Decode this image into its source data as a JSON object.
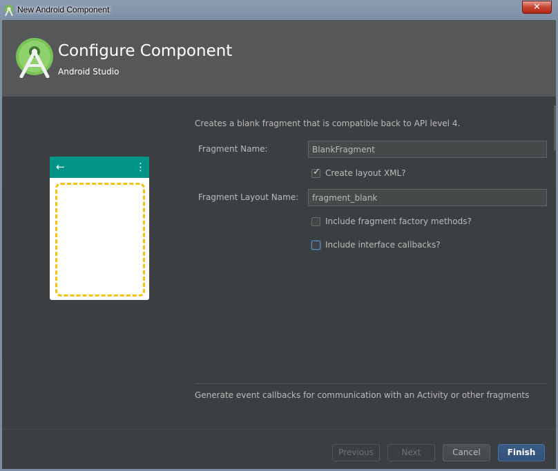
{
  "window": {
    "title": "New Android Component"
  },
  "header": {
    "title": "Configure Component",
    "subtitle": "Android Studio"
  },
  "form": {
    "description": "Creates a blank fragment that is compatible back to API level 4.",
    "fragment_name": {
      "label": "Fragment Name:",
      "value": "BlankFragment"
    },
    "create_layout_xml": {
      "label": "Create layout XML?",
      "checked": true
    },
    "fragment_layout_name": {
      "label": "Fragment Layout Name:",
      "value": "fragment_blank"
    },
    "include_factory_methods": {
      "label": "Include fragment factory methods?",
      "checked": false
    },
    "include_interface_callbacks": {
      "label": "Include interface callbacks?",
      "checked": false
    }
  },
  "help_text": "Generate event callbacks for communication with an Activity or other fragments",
  "buttons": {
    "previous": "Previous",
    "next": "Next",
    "cancel": "Cancel",
    "finish": "Finish"
  },
  "icons": {
    "close": "close-icon",
    "back": "arrow-back-icon",
    "menu": "overflow-menu-icon",
    "checkmark": "checkmark-icon",
    "logo": "android-studio-logo"
  },
  "colors": {
    "accent": "#009587",
    "fragment_outline": "#f5c10d",
    "primary_button": "#3a5c86"
  },
  "glyphs": {
    "back_arrow": "←",
    "menu_dots": "⋮",
    "close": "✕",
    "check": "✓"
  }
}
